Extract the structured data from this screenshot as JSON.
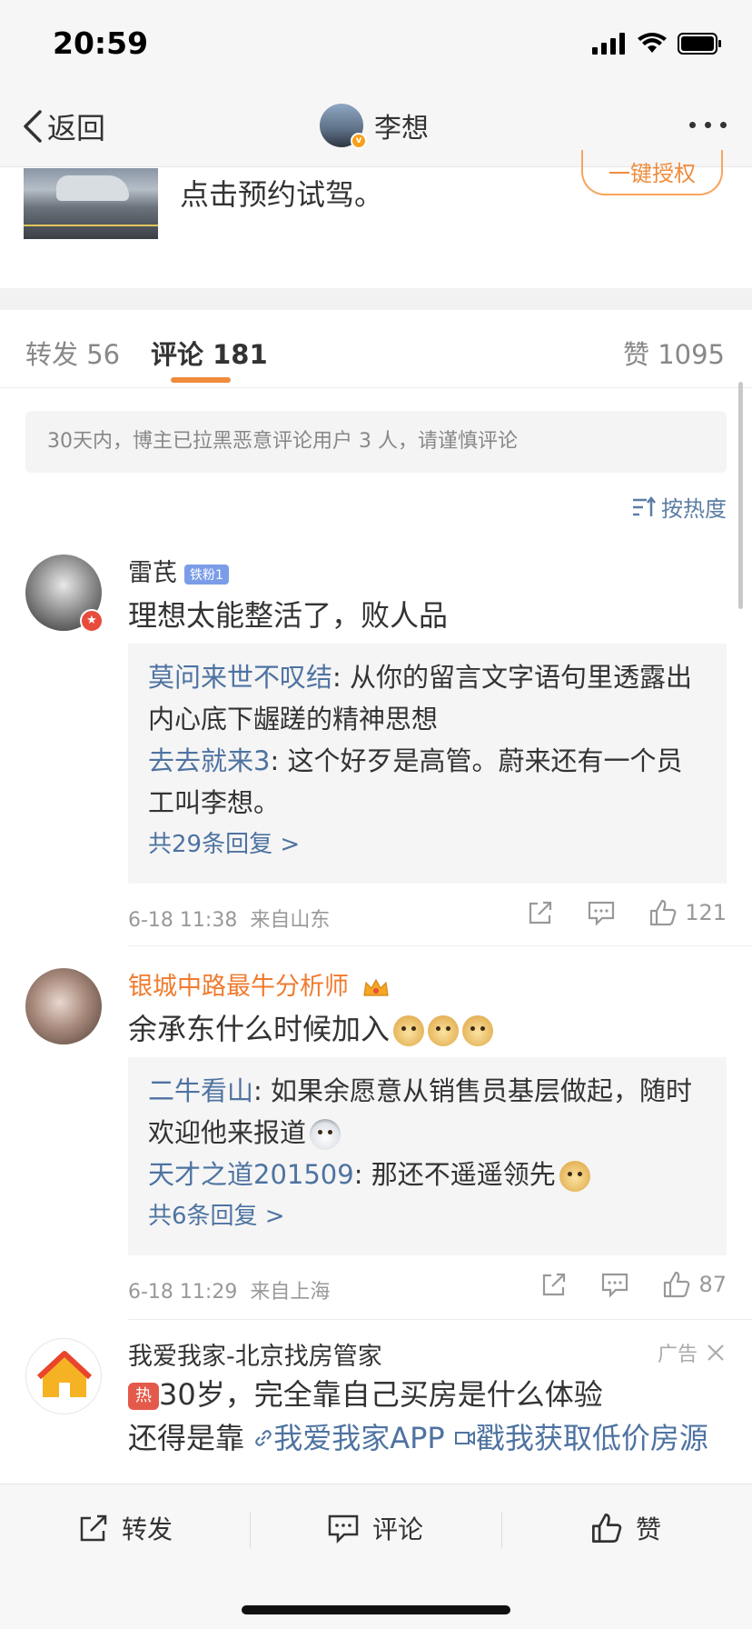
{
  "status_bar": {
    "time": "20:59"
  },
  "nav": {
    "back_label": "返回",
    "title": "李想"
  },
  "post": {
    "text_fragment": "点击预约试驾。",
    "auth_button": "一键授权"
  },
  "tabs": [
    {
      "label": "转发",
      "count": "56"
    },
    {
      "label": "评论",
      "count": "181"
    },
    {
      "label": "赞",
      "count": "1095"
    }
  ],
  "notice": "30天内，博主已拉黑恶意评论用户 3 人，请谨慎评论",
  "sort_label": "按热度",
  "comments": [
    {
      "name": "雷芪",
      "badge": "铁粉1",
      "text": "理想太能整活了，败人品",
      "replies": [
        {
          "user": "莫问来世不叹结",
          "text": ": 从你的留言文字语句里透露出内心底下龌蹉的精神思想"
        },
        {
          "user": "去去就来3",
          "text": ": 这个好歹是高管。蔚来还有一个员工叫李想。"
        }
      ],
      "more_replies": "共29条回复 >",
      "time": "6-18 11:38",
      "location": "来自山东",
      "likes": "121"
    },
    {
      "name": "银城中路最牛分析师",
      "text": "余承东什么时候加入",
      "replies": [
        {
          "user": "二牛看山",
          "text": ": 如果余愿意从销售员基层做起，随时欢迎他来报道"
        },
        {
          "user": "天才之道201509",
          "text": ": 那还不遥遥领先"
        }
      ],
      "more_replies": "共6条回复 >",
      "time": "6-18 11:29",
      "location": "来自上海",
      "likes": "87"
    }
  ],
  "ad": {
    "name": "我爱我家-北京找房管家",
    "label": "广告",
    "tag": "热",
    "line1": "30岁，完全靠自己买房是什么体验",
    "line2_prefix": "还得是靠",
    "link1": "我爱我家APP",
    "link2": "戳我获取低价房源"
  },
  "toolbar": {
    "repost": "转发",
    "comment": "评论",
    "like": "赞"
  }
}
